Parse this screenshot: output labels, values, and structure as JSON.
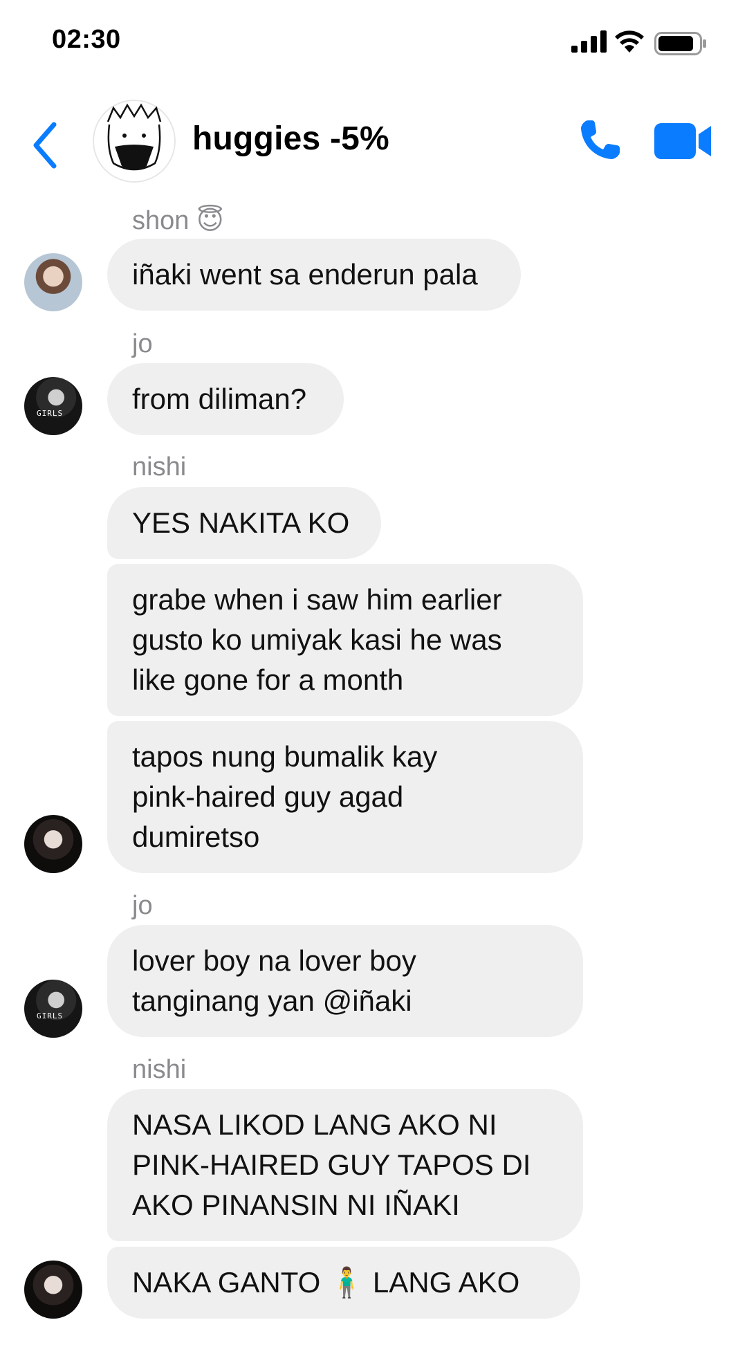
{
  "status_bar": {
    "time": "02:30",
    "icons": [
      "signal-icon",
      "wifi-icon",
      "battery-icon"
    ]
  },
  "header": {
    "title": "huggies -5%",
    "accent_color": "#0a7cff",
    "icons": [
      "back-chevron-icon",
      "phone-icon",
      "video-camera-icon"
    ]
  },
  "messages": [
    {
      "sender": "shon 😇",
      "text": "iñaki went sa enderun pala"
    },
    {
      "sender": "jo",
      "text": "from diliman?"
    },
    {
      "sender": "nishi",
      "text": "YES NAKITA KO"
    },
    {
      "text": "grabe when i saw him earlier\ngusto ko umiyak kasi he was\nlike gone for a month"
    },
    {
      "text": "tapos nung bumalik kay\npink-haired guy agad\ndumiretso"
    },
    {
      "sender": "jo",
      "text": "lover boy na lover boy\ntanginang yan @iñaki"
    },
    {
      "sender": "nishi",
      "text": "NASA LIKOD LANG AKO NI\nPINK-HAIRED GUY TAPOS DI\nAKO PINANSIN NI IÑAKI"
    },
    {
      "text": "NAKA GANTO 🧍‍♂️ LANG AKO"
    }
  ],
  "colors": {
    "bubble": "#efefef",
    "sender_name": "#8a8a8e"
  }
}
